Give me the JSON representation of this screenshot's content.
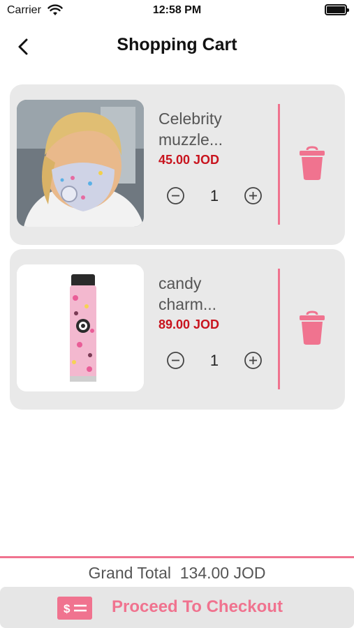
{
  "status_bar": {
    "carrier": "Carrier",
    "time": "12:58 PM"
  },
  "header": {
    "title": "Shopping Cart"
  },
  "cart": {
    "items": [
      {
        "name": "Celebrity muzzle...",
        "price": "45.00 JOD",
        "quantity": "1",
        "image": "face-mask-photo"
      },
      {
        "name": "candy charm...",
        "price": "89.00 JOD",
        "quantity": "1",
        "image": "tumbler-bottle-photo"
      }
    ]
  },
  "footer": {
    "grand_total_label": "Grand Total",
    "grand_total_value": "134.00 JOD",
    "checkout_label": "Proceed To Checkout"
  },
  "colors": {
    "accent": "#f0738f",
    "price": "#c8141e",
    "card": "#e9e9e9"
  },
  "icons": [
    "wifi-icon",
    "battery-icon",
    "back-chevron-icon",
    "minus-circle-icon",
    "plus-circle-icon",
    "trash-icon",
    "dollar-card-icon"
  ]
}
